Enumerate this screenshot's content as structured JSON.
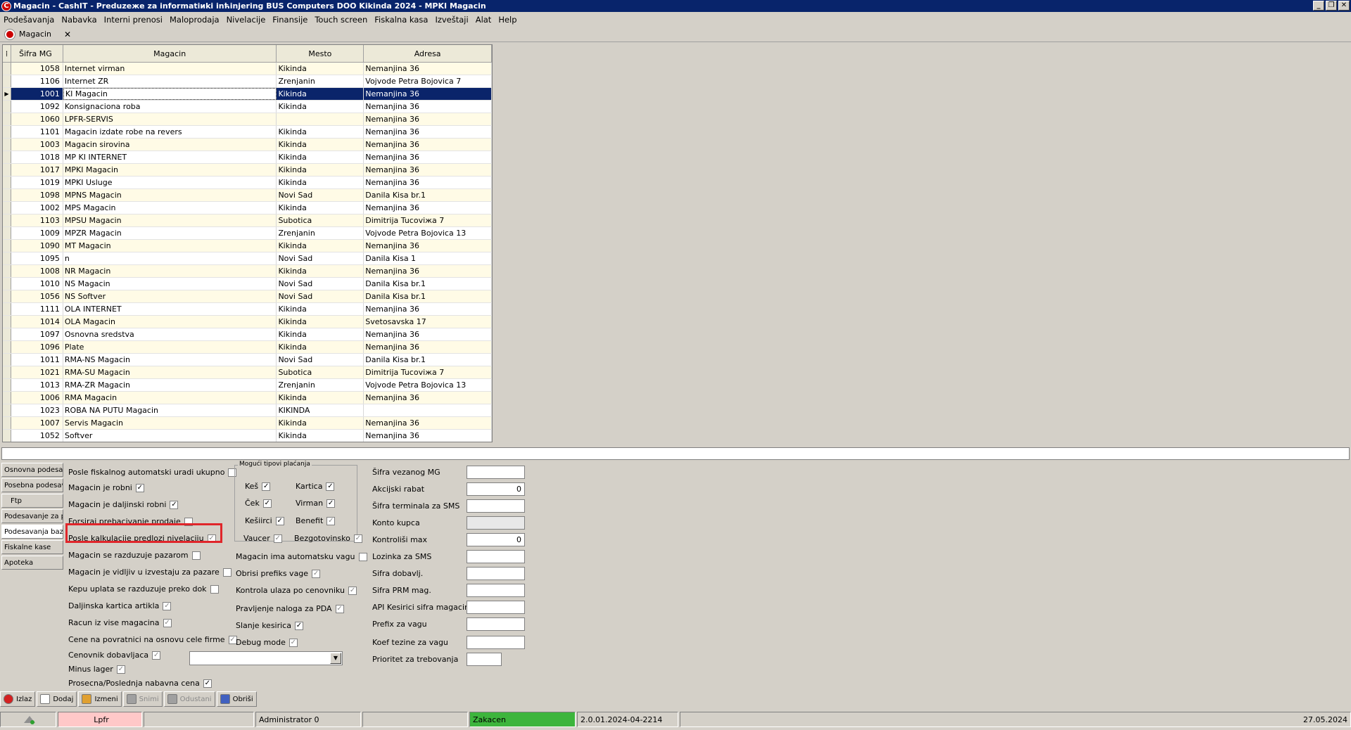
{
  "window": {
    "title": "Magacin - CashIT - Preduzeжe za informatiиki inћinjering BUS Computers DOO Kikinda 2024 - MPKI Magacin",
    "app_icon": "C"
  },
  "menu": [
    "Podešavanja",
    "Nabavka",
    "Interni prenosi",
    "Maloprodaja",
    "Nivelacije",
    "Finansije",
    "Touch screen",
    "Fiskalna kasa",
    "Izveštaji",
    "Alat",
    "Help"
  ],
  "tab": {
    "label": "Magacin",
    "close": "✕"
  },
  "grid": {
    "columns": [
      "Šifra MG",
      "Magacin",
      "Mesto",
      "Adresa"
    ],
    "rows": [
      {
        "sifra": "1058",
        "magacin": "Internet virman",
        "mesto": "Kikinda",
        "adresa": "Nemanjina 36"
      },
      {
        "sifra": "1106",
        "magacin": "Internet ZR",
        "mesto": "Zrenjanin",
        "adresa": "Vojvode Petra Bojovica 7"
      },
      {
        "sifra": "1001",
        "magacin": "KI Magacin",
        "mesto": "Kikinda",
        "adresa": "Nemanjina 36",
        "selected": true
      },
      {
        "sifra": "1092",
        "magacin": "Konsignaciona roba",
        "mesto": "Kikinda",
        "adresa": "Nemanjina 36"
      },
      {
        "sifra": "1060",
        "magacin": "LPFR-SERVIS",
        "mesto": "",
        "adresa": "Nemanjina 36"
      },
      {
        "sifra": "1101",
        "magacin": "Magacin izdate robe na revers",
        "mesto": "Kikinda",
        "adresa": "Nemanjina 36"
      },
      {
        "sifra": "1003",
        "magacin": "Magacin sirovina",
        "mesto": "Kikinda",
        "adresa": "Nemanjina 36"
      },
      {
        "sifra": "1018",
        "magacin": "MP KI INTERNET",
        "mesto": "Kikinda",
        "adresa": "Nemanjina 36"
      },
      {
        "sifra": "1017",
        "magacin": "MPKI Magacin",
        "mesto": "Kikinda",
        "adresa": "Nemanjina 36"
      },
      {
        "sifra": "1019",
        "magacin": "MPKI Usluge",
        "mesto": "Kikinda",
        "adresa": "Nemanjina 36"
      },
      {
        "sifra": "1098",
        "magacin": "MPNS Magacin",
        "mesto": "Novi Sad",
        "adresa": "Danila Kisa br.1"
      },
      {
        "sifra": "1002",
        "magacin": "MPS Magacin",
        "mesto": "Kikinda",
        "adresa": "Nemanjina 36"
      },
      {
        "sifra": "1103",
        "magacin": "MPSU Magacin",
        "mesto": "Subotica",
        "adresa": "Dimitrija Tucoviжa 7"
      },
      {
        "sifra": "1009",
        "magacin": "MPZR Magacin",
        "mesto": "Zrenjanin",
        "adresa": "Vojvode Petra Bojovica 13"
      },
      {
        "sifra": "1090",
        "magacin": "MT Magacin",
        "mesto": "Kikinda",
        "adresa": "Nemanjina 36"
      },
      {
        "sifra": "1095",
        "magacin": "n",
        "mesto": "Novi Sad",
        "adresa": "Danila Kisa 1"
      },
      {
        "sifra": "1008",
        "magacin": "NR Magacin",
        "mesto": "Kikinda",
        "adresa": "Nemanjina 36"
      },
      {
        "sifra": "1010",
        "magacin": "NS Magacin",
        "mesto": "Novi Sad",
        "adresa": "Danila Kisa br.1"
      },
      {
        "sifra": "1056",
        "magacin": "NS Softver",
        "mesto": "Novi Sad",
        "adresa": "Danila Kisa br.1"
      },
      {
        "sifra": "1111",
        "magacin": "OLA INTERNET",
        "mesto": "Kikinda",
        "adresa": "Nemanjina 36"
      },
      {
        "sifra": "1014",
        "magacin": "OLA Magacin",
        "mesto": "Kikinda",
        "adresa": "Svetosavska 17"
      },
      {
        "sifra": "1097",
        "magacin": "Osnovna sredstva",
        "mesto": "Kikinda",
        "adresa": "Nemanjina 36"
      },
      {
        "sifra": "1096",
        "magacin": "Plate",
        "mesto": "Kikinda",
        "adresa": "Nemanjina 36"
      },
      {
        "sifra": "1011",
        "magacin": "RMA-NS Magacin",
        "mesto": "Novi Sad",
        "adresa": "Danila Kisa br.1"
      },
      {
        "sifra": "1021",
        "magacin": "RMA-SU Magacin",
        "mesto": "Subotica",
        "adresa": "Dimitrija Tucoviжa 7"
      },
      {
        "sifra": "1013",
        "magacin": "RMA-ZR Magacin",
        "mesto": "Zrenjanin",
        "adresa": "Vojvode Petra Bojovica 13"
      },
      {
        "sifra": "1006",
        "magacin": "RMA Magacin",
        "mesto": "Kikinda",
        "adresa": "Nemanjina 36"
      },
      {
        "sifra": "1023",
        "magacin": "ROBA NA PUTU Magacin",
        "mesto": "KIKINDA",
        "adresa": ""
      },
      {
        "sifra": "1007",
        "magacin": "Servis Magacin",
        "mesto": "Kikinda",
        "adresa": "Nemanjina 36"
      },
      {
        "sifra": "1052",
        "magacin": "Softver",
        "mesto": "Kikinda",
        "adresa": "Nemanjina 36"
      }
    ]
  },
  "side_tabs": [
    "Osnovna podesa...",
    "Posebna podesav...",
    "Ftp",
    "Podesavanje za p...",
    "Podesavanja baz...",
    "Fiskalne kase",
    "Apoteka"
  ],
  "options_col1": [
    {
      "label": "Posle fiskalnog automatski uradi ukupno",
      "checked": false
    },
    {
      "label": "Magacin je robni",
      "checked": true
    },
    {
      "label": "Magacin je daljinski robni",
      "checked": true
    },
    {
      "label": "Forsiraj prebacivanje prodaje",
      "checked": false
    },
    {
      "label": "Posle kalkulacije predlozi nivelaciju",
      "checked": true,
      "disabled": true
    },
    {
      "label": "Magacin se razduzuje pazarom",
      "checked": false
    },
    {
      "label": "Magacin je vidljiv u izvestaju za pazare",
      "checked": false
    },
    {
      "label": "Kepu uplata se razduzuje preko dok",
      "checked": false
    },
    {
      "label": "Daljinska kartica artikla",
      "checked": true,
      "disabled": true
    },
    {
      "label": "Racun iz vise magacina",
      "checked": true,
      "disabled": true
    },
    {
      "label": "Cene na povratnici na osnovu cele firme",
      "checked": true,
      "disabled": true
    },
    {
      "label": "Cenovnik dobavljaca",
      "checked": true,
      "disabled": true
    },
    {
      "label": "Minus lager",
      "checked": true,
      "disabled": true
    },
    {
      "label": "Prosecna/Poslednja nabavna cena",
      "checked": true
    }
  ],
  "payments": {
    "legend": "Mogući tipovi plaćanja",
    "items": [
      {
        "label": "Keš",
        "checked": true
      },
      {
        "label": "Kartica",
        "checked": true
      },
      {
        "label": "Ček",
        "checked": true
      },
      {
        "label": "Virman",
        "checked": true
      },
      {
        "label": "Kešiirci",
        "checked": true
      },
      {
        "label": "Benefit",
        "checked": true,
        "disabled": true
      },
      {
        "label": "Vaucer",
        "checked": true,
        "disabled": true
      },
      {
        "label": "Bezgotovinsko",
        "checked": true,
        "disabled": true
      }
    ]
  },
  "options_col2": [
    {
      "label": "Magacin ima automatsku vagu",
      "checked": false
    },
    {
      "label": "Obrisi prefiks vage",
      "checked": true,
      "disabled": true
    },
    {
      "label": "Kontrola ulaza po cenovniku",
      "checked": true,
      "disabled": true
    },
    {
      "label": "Pravljenje naloga za PDA",
      "checked": true,
      "disabled": true
    },
    {
      "label": "Slanje kesirica",
      "checked": true
    },
    {
      "label": "Debug mode",
      "checked": true,
      "disabled": true
    }
  ],
  "fields": [
    {
      "label": "Šifra vezanog MG",
      "value": ""
    },
    {
      "label": "Akcijski rabat",
      "value": "0"
    },
    {
      "label": "Šifra terminala za SMS",
      "value": ""
    },
    {
      "label": "Konto kupca",
      "value": "",
      "gray": true
    },
    {
      "label": "Kontroliši max",
      "value": "0"
    },
    {
      "label": "Lozinka za SMS",
      "value": ""
    },
    {
      "label": "Sifra dobavlj.",
      "value": ""
    },
    {
      "label": "Sifra PRM mag.",
      "value": ""
    },
    {
      "label": "API Kesirici sifra magacina",
      "value": ""
    },
    {
      "label": "Prefix za vagu",
      "value": ""
    },
    {
      "label": "Koef tezine za vagu",
      "value": ""
    },
    {
      "label": "Prioritet za trebovanja",
      "value": ""
    }
  ],
  "toolbar": [
    {
      "label": "Izlaz",
      "icon": "exit-icon",
      "color": "#d42020"
    },
    {
      "label": "Dodaj",
      "icon": "new-document-icon",
      "color": "#ffffff"
    },
    {
      "label": "Izmeni",
      "icon": "edit-icon",
      "color": "#e0a030"
    },
    {
      "label": "Snimi",
      "icon": "save-icon",
      "color": "#a0a0a0",
      "disabled": true
    },
    {
      "label": "Odustani",
      "icon": "cancel-icon",
      "color": "#a0a0a0",
      "disabled": true
    },
    {
      "label": "Obriši",
      "icon": "delete-icon",
      "color": "#4060c0"
    }
  ],
  "status": {
    "lpfr": "Lpfr",
    "user": "Administrator 0",
    "lock": "Zakacen",
    "version": "2.0.01.2024-04-2214",
    "date": "27.05.2024"
  }
}
